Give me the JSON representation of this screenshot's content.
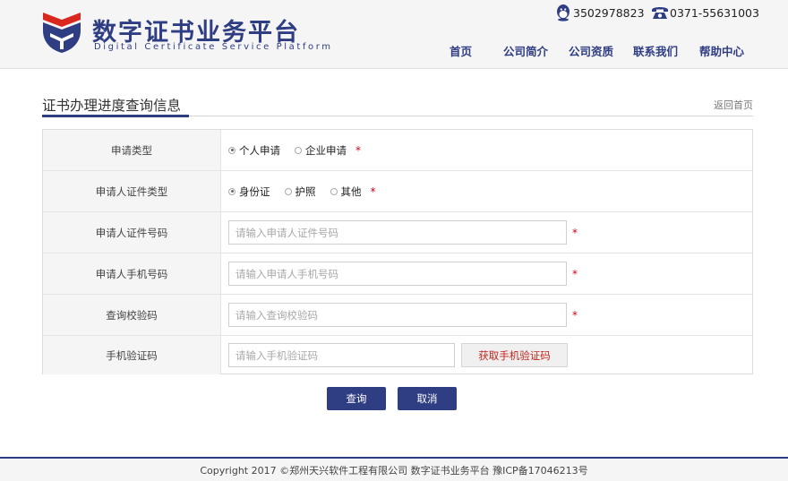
{
  "header": {
    "logo_title": "数字证书业务平台",
    "logo_subtitle": "Digital Certificate Service Platform",
    "qq_number": "3502978823",
    "phone_number": "0371-55631003",
    "nav": {
      "home": "首页",
      "about": "公司简介",
      "qualification": "公司资质",
      "contact": "联系我们",
      "help": "帮助中心"
    }
  },
  "section": {
    "title": "证书办理进度查询信息",
    "back_link": "返回首页"
  },
  "form": {
    "apply_type": {
      "label": "申请类型",
      "options": [
        "个人申请",
        "企业申请"
      ],
      "selected": "个人申请"
    },
    "id_type": {
      "label": "申请人证件类型",
      "options": [
        "身份证",
        "护照",
        "其他"
      ],
      "selected": "身份证"
    },
    "id_number": {
      "label": "申请人证件号码",
      "placeholder": "请输入申请人证件号码",
      "value": ""
    },
    "mobile": {
      "label": "申请人手机号码",
      "placeholder": "请输入申请人手机号码",
      "value": ""
    },
    "query_code": {
      "label": "查询校验码",
      "placeholder": "请输入查询校验码",
      "value": ""
    },
    "sms_code": {
      "label": "手机验证码",
      "placeholder": "请输入手机验证码",
      "value": "",
      "button": "获取手机验证码"
    },
    "required_mark": "*"
  },
  "actions": {
    "query": "查询",
    "cancel": "取消"
  },
  "footer": {
    "text": "Copyright 2017 ©郑州天兴软件工程有限公司 数字证书业务平台 豫ICP备17046213号"
  },
  "colors": {
    "brand": "#2f3d83",
    "accent_red": "#c0261c",
    "required": "#d0021b"
  }
}
